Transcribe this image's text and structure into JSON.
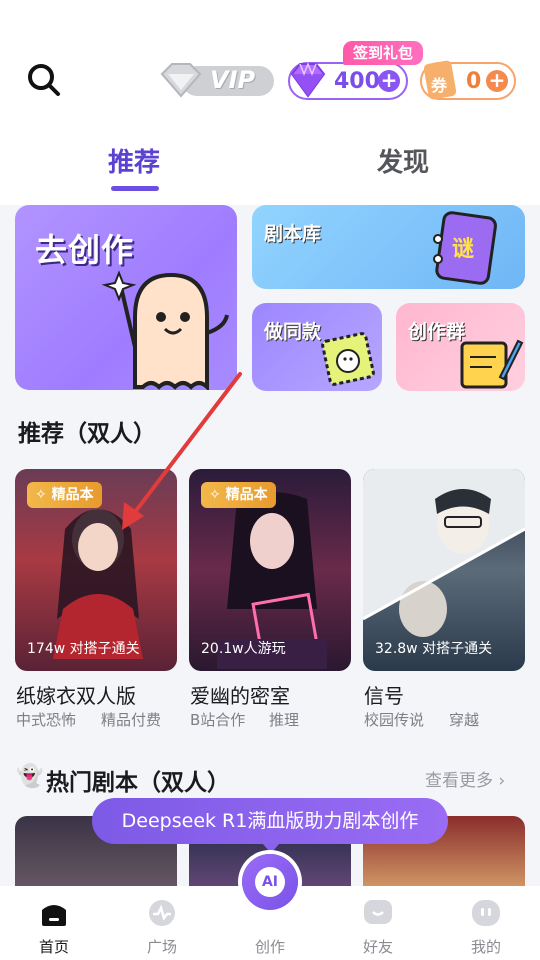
{
  "header": {
    "vip_label": "VIP",
    "sign_badge": "签到礼包",
    "coins": "400",
    "tickets": "0",
    "ticket_icon_char": "券"
  },
  "tabs": [
    {
      "label": "推荐",
      "active": true
    },
    {
      "label": "发现",
      "active": false
    }
  ],
  "banner": {
    "create": "去创作",
    "library": "剧本库",
    "library_icon_char": "谜",
    "same": "做同款",
    "group": "创作群"
  },
  "recommend": {
    "title": "推荐（双人）",
    "items": [
      {
        "badge": "精品本",
        "stat": "174w 对搭子通关",
        "name": "纸嫁衣双人版",
        "tags": [
          "中式恐怖",
          "精品付费"
        ]
      },
      {
        "badge": "精品本",
        "stat": "20.1w人游玩",
        "name": "爱幽的密室",
        "tags": [
          "B站合作",
          "推理"
        ]
      },
      {
        "badge": "",
        "stat": "32.8w 对搭子通关",
        "name": "信号",
        "tags": [
          "校园传说",
          "穿越"
        ]
      }
    ]
  },
  "hot": {
    "title": "热门剧本（双人）",
    "more": "查看更多"
  },
  "tip": "Deepseek R1满血版助力剧本创作",
  "nav": {
    "items": [
      {
        "label": "首页",
        "icon": "home-icon",
        "active": true
      },
      {
        "label": "广场",
        "icon": "plaza-icon",
        "active": false
      },
      {
        "label": "创作",
        "icon": "ai-create-icon",
        "active": false
      },
      {
        "label": "好友",
        "icon": "friends-icon",
        "active": false
      },
      {
        "label": "我的",
        "icon": "profile-icon",
        "active": false
      }
    ],
    "ai_label": "AI"
  },
  "colors": {
    "accent": "#6b4fe0",
    "coin": "#7b4dea",
    "ticket": "#f07f3c",
    "badge_gold": "#e89a2d",
    "arrow_red": "#e23b3b"
  }
}
